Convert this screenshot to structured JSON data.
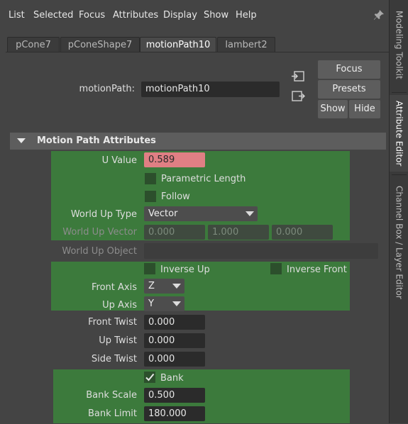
{
  "menu": [
    "List",
    "Selected",
    "Focus",
    "Attributes",
    "Display",
    "Show",
    "Help"
  ],
  "side_tabs": [
    "Modeling Toolkit",
    "Attribute Editor",
    "Channel Box / Layer Editor"
  ],
  "node_tabs": [
    "pCone7",
    "pConeShape7",
    "motionPath10",
    "lambert2"
  ],
  "header": {
    "node_label": "motionPath:",
    "node_name": "motionPath10",
    "focus": "Focus",
    "presets": "Presets",
    "show": "Show",
    "hide": "Hide"
  },
  "section": {
    "title": "Motion Path Attributes"
  },
  "attrs": {
    "u_value_label": "U Value",
    "u_value": "0.589",
    "parametric_length": "Parametric Length",
    "follow": "Follow",
    "world_up_type_label": "World Up Type",
    "world_up_type": "Vector",
    "world_up_vector_label": "World Up Vector",
    "world_up_vector": [
      "0.000",
      "1.000",
      "0.000"
    ],
    "world_up_object_label": "World Up Object",
    "inverse_up": "Inverse Up",
    "inverse_front": "Inverse Front",
    "front_axis_label": "Front Axis",
    "front_axis": "Z",
    "up_axis_label": "Up Axis",
    "up_axis": "Y",
    "front_twist_label": "Front Twist",
    "front_twist": "0.000",
    "up_twist_label": "Up Twist",
    "up_twist": "0.000",
    "side_twist_label": "Side Twist",
    "side_twist": "0.000",
    "bank": "Bank",
    "bank_scale_label": "Bank Scale",
    "bank_scale": "0.500",
    "bank_limit_label": "Bank Limit",
    "bank_limit": "180.000"
  },
  "colors": {
    "u_value_keyed": "#e07f84",
    "green_section": "#3c7a3c"
  }
}
